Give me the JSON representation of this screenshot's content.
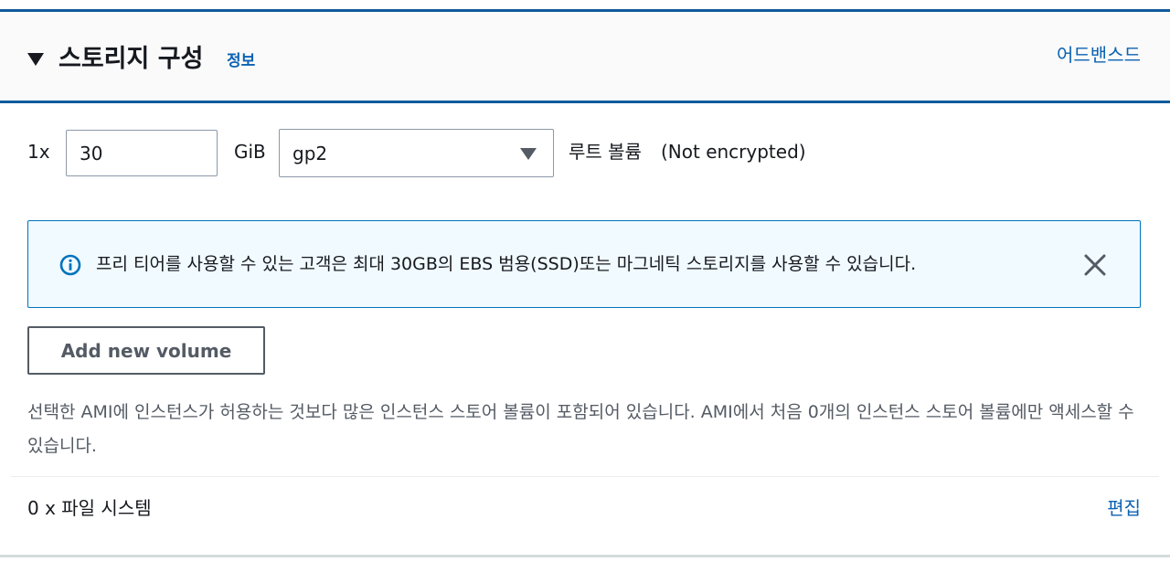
{
  "section": {
    "title": "스토리지 구성",
    "info_link": "정보",
    "advanced_link": "어드밴스드"
  },
  "root_volume": {
    "quantity": "1x",
    "size_value": "30",
    "size_unit": "GiB",
    "volume_type": "gp2",
    "label": "루트 볼륨",
    "encryption": "(Not encrypted)"
  },
  "alert": {
    "icon": "info-icon",
    "text": "프리 티어를 사용할 수 있는 고객은 최대 30GB의 EBS 범용(SSD)또는 마그네틱 스토리지를 사용할 수 있습니다.",
    "close_icon": "close-icon",
    "accent_color": "#0073bb",
    "background_color": "#f1faff"
  },
  "buttons": {
    "add_volume": "Add new volume"
  },
  "instance_store_note": "선택한 AMI에 인스턴스가 허용하는 것보다 많은 인스턴스 스토어 볼륨이 포함되어 있습니다. AMI에서 처음 0개의 인스턴스 스토어 볼륨에만 액세스할 수 있습니다.",
  "file_systems": {
    "label": "0 x 파일 시스템",
    "edit_link": "편집"
  },
  "colors": {
    "link": "#0b62b3",
    "header_border": "#0f5b9c",
    "text": "#16191f",
    "muted_text": "#545b64"
  }
}
